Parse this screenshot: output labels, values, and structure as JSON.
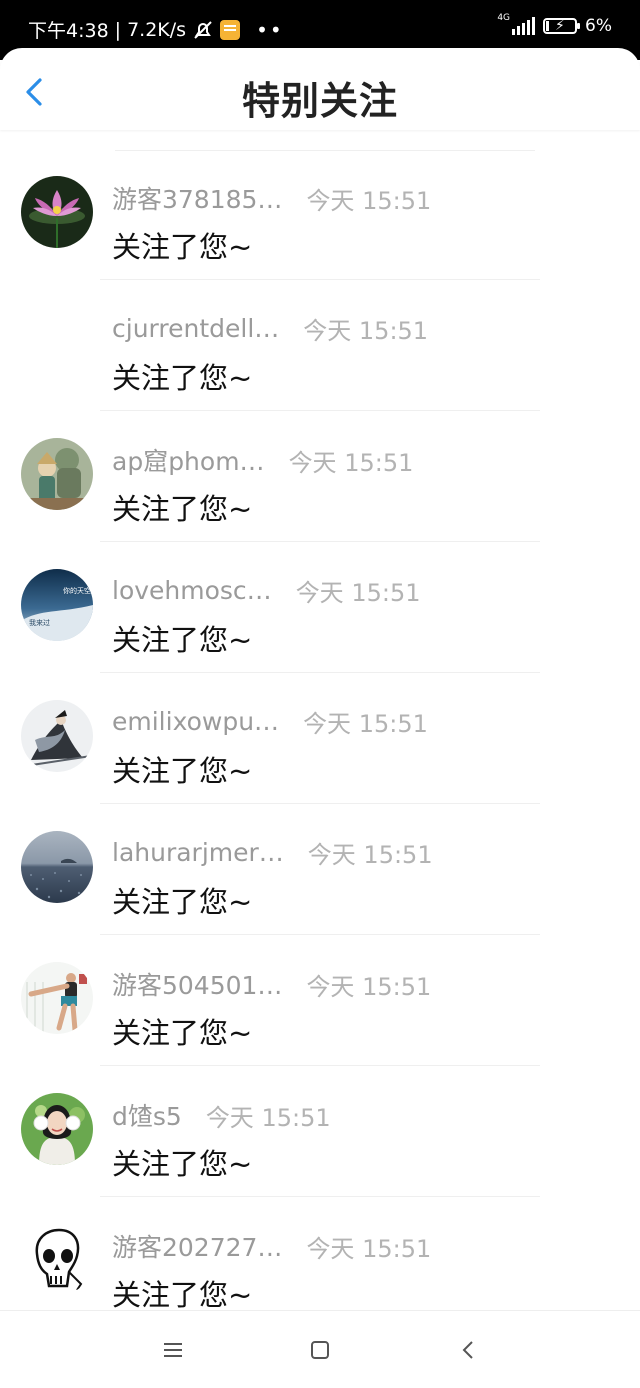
{
  "status_bar": {
    "time": "下午4:38",
    "speed": "7.2K/s",
    "network": "4G",
    "battery": "6%"
  },
  "header": {
    "title": "特别关注",
    "back_icon": "chevron-left-icon"
  },
  "items": [
    {
      "name": "游客378185…",
      "time": "今天 15:51",
      "message": "关注了您~",
      "avatar": "lotus"
    },
    {
      "name": "cjurrentdell…",
      "time": "今天 15:51",
      "message": "关注了您~",
      "avatar": "none"
    },
    {
      "name": "ap窟phom…",
      "time": "今天 15:51",
      "message": "关注了您~",
      "avatar": "character"
    },
    {
      "name": "lovehmosc…",
      "time": "今天 15:51",
      "message": "关注了您~",
      "avatar": "sky",
      "avatar_text_top": "你的天空",
      "avatar_text_bottom": "我来过"
    },
    {
      "name": "emilixowpu…",
      "time": "今天 15:51",
      "message": "关注了您~",
      "avatar": "ink-painting"
    },
    {
      "name": "lahurarjmer…",
      "time": "今天 15:51",
      "message": "关注了您~",
      "avatar": "sea"
    },
    {
      "name": "游客504501…",
      "time": "今天 15:51",
      "message": "关注了您~",
      "avatar": "kick"
    },
    {
      "name": "d馇s5",
      "time": "今天 15:51",
      "message": "关注了您~",
      "avatar": "girl"
    },
    {
      "name": "游客202727…",
      "time": "今天 15:51",
      "message": "关注了您~",
      "avatar": "skull"
    }
  ],
  "nav_bar": {
    "menu_icon": "menu-icon",
    "home_icon": "square-home-icon",
    "back_icon": "triangle-back-icon"
  }
}
